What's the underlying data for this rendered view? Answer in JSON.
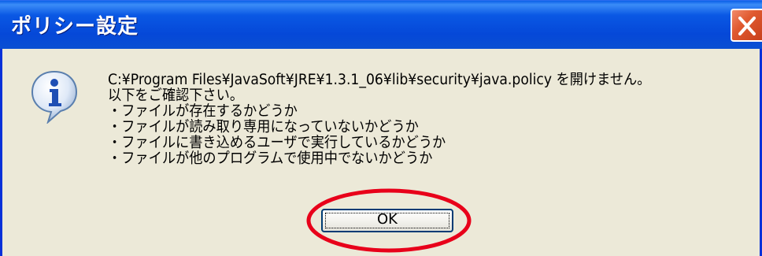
{
  "window": {
    "title": "ポリシー設定"
  },
  "dialog": {
    "icon": "info-icon",
    "message_lines": [
      "C:¥Program Files¥JavaSoft¥JRE¥1.3.1_06¥lib¥security¥java.policy を開けません。",
      "以下をご確認下さい。",
      "・ファイルが存在するかどうか",
      "・ファイルが読み取り専用になっていないかどうか",
      "・ファイルに書き込めるユーザで実行しているかどうか",
      "・ファイルが他のプログラムで使用中でないかどうか"
    ],
    "ok_label": "OK"
  },
  "colors": {
    "titlebar": "#0a58e4",
    "body": "#ece9d8",
    "close_button": "#e05a30",
    "annotation": "#e8001a"
  }
}
